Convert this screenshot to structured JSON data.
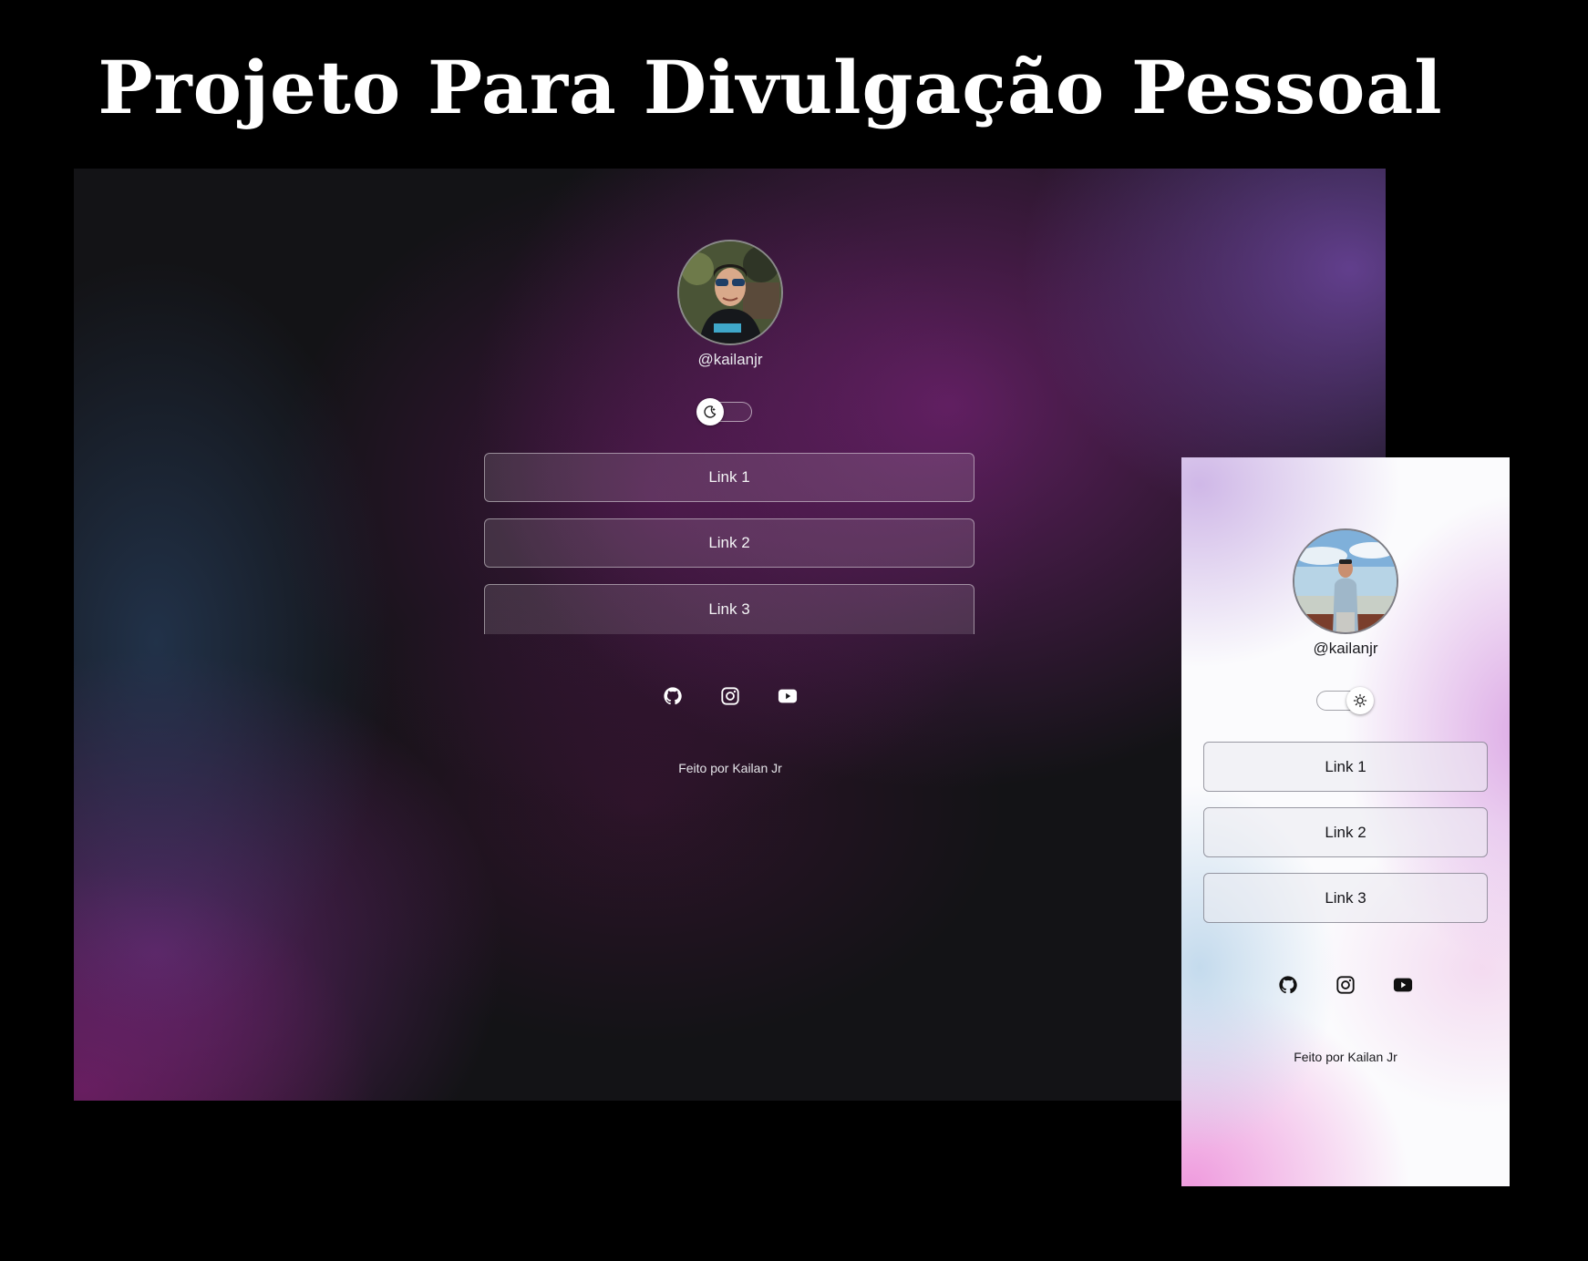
{
  "headline": "Projeto Para Divulgação Pessoal",
  "desktop_preview": {
    "theme": "dark",
    "handle": "@kailanjr",
    "theme_toggle": {
      "state": "dark",
      "knob_icon": "moon-icon"
    },
    "links": [
      {
        "label": "Link 1"
      },
      {
        "label": "Link 2"
      },
      {
        "label": "Link 3"
      }
    ],
    "social_icons": [
      "github-icon",
      "instagram-icon",
      "youtube-icon"
    ],
    "footer": "Feito por Kailan Jr",
    "colors": {
      "background": "#131316",
      "accent_purple": "#782378",
      "text": "#f4f4f6"
    }
  },
  "mobile_preview": {
    "theme": "light",
    "handle": "@kailanjr",
    "theme_toggle": {
      "state": "light",
      "knob_icon": "sun-icon"
    },
    "links": [
      {
        "label": "Link 1"
      },
      {
        "label": "Link 2"
      },
      {
        "label": "Link 3"
      }
    ],
    "social_icons": [
      "github-icon",
      "instagram-icon",
      "youtube-icon"
    ],
    "footer": "Feito por Kailan Jr",
    "colors": {
      "background": "#fbfbfd",
      "accent_pink": "#ee96dc",
      "text": "#141418"
    }
  }
}
